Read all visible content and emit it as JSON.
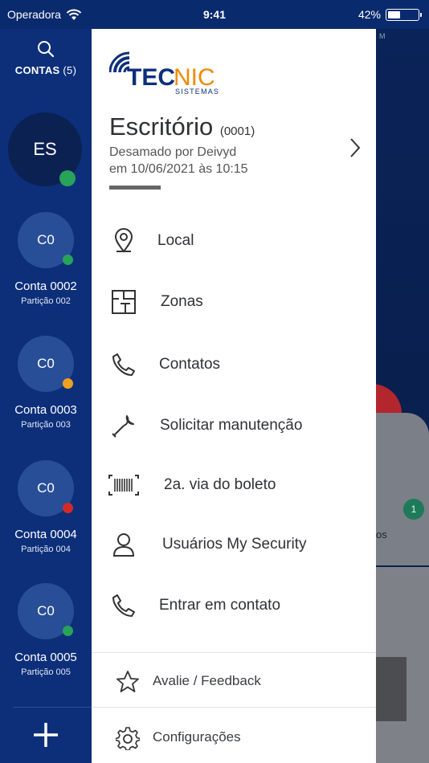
{
  "status_bar": {
    "carrier": "Operadora",
    "time": "9:41",
    "battery": "42%",
    "battery_level": 0.42
  },
  "rail": {
    "contas_label": "CONTAS",
    "contas_count": "(5)",
    "selected": {
      "initials": "ES",
      "status_color": "#27a35a"
    },
    "accounts": [
      {
        "initials": "C0",
        "name": "Conta 0002",
        "partition": "Partição 002",
        "status_color": "#27a35a"
      },
      {
        "initials": "C0",
        "name": "Conta 0003",
        "partition": "Partição 003",
        "status_color": "#f0a020"
      },
      {
        "initials": "C0",
        "name": "Conta 0004",
        "partition": "Partição 004",
        "status_color": "#d32a2a"
      },
      {
        "initials": "C0",
        "name": "Conta 0005",
        "partition": "Partição 005",
        "status_color": "#27a35a"
      }
    ]
  },
  "drawer": {
    "logo": {
      "brand_a": "TEC",
      "brand_b": "NIC",
      "subtitle": "SISTEMAS",
      "color_a": "#0d2f7a",
      "color_b": "#f08a00"
    },
    "account_name": "Escritório",
    "account_number": "(0001)",
    "status_line1": "Desamado por Deivyd",
    "status_line2": "em  10/06/2021 às 10:15",
    "menu": [
      {
        "icon": "location-pin-icon",
        "label": "Local"
      },
      {
        "icon": "floorplan-icon",
        "label": "Zonas"
      },
      {
        "icon": "phone-icon",
        "label": "Contatos"
      },
      {
        "icon": "wrench-icon",
        "label": "Solicitar manutenção"
      },
      {
        "icon": "barcode-icon",
        "label": "2a. via do boleto"
      },
      {
        "icon": "user-icon",
        "label": "Usuários My Security"
      },
      {
        "icon": "phone-icon",
        "label": "Entrar em contato"
      }
    ],
    "footer": [
      {
        "icon": "star-icon",
        "label": "Avalie / Feedback"
      },
      {
        "icon": "gear-icon",
        "label": "Configurações"
      }
    ]
  },
  "background": {
    "badge": "1",
    "fragment": "os"
  }
}
